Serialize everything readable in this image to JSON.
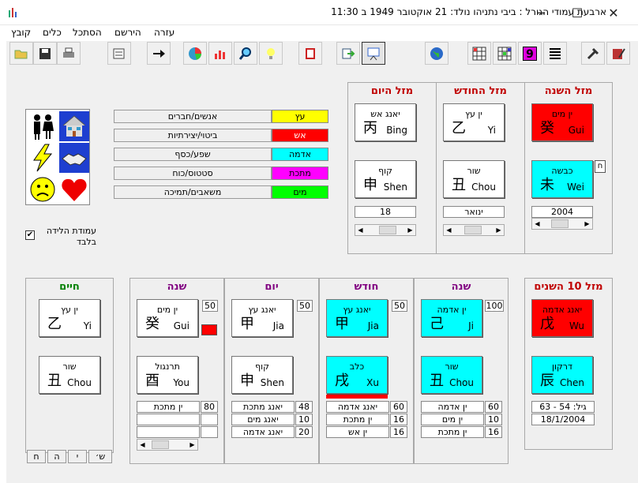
{
  "window": {
    "title": "ארבעת עמודי הגורל : ביבי נתניהו   נולד: 21 אוקטובר 1949 ב 11:30",
    "min": "─",
    "max": "☐",
    "close": "✕"
  },
  "menu": [
    "קובץ",
    "כלים",
    "הסתכל",
    "הירשם",
    "עזרה"
  ],
  "toolbar_icons": [
    "open-folder-icon",
    "save-icon",
    "print-icon",
    "properties-icon",
    "arrow-right-icon",
    "pie-chart-icon",
    "bar-chart-icon",
    "magnifier-icon",
    "bulb-icon",
    "book-icon",
    "export-icon",
    "presentation-icon",
    "globe-icon",
    "grid-a-icon",
    "grid-b-icon",
    "nine-icon",
    "list-lines-icon",
    "tools-icon",
    "book-pen-icon"
  ],
  "toolbar_nine": "9",
  "elements": [
    {
      "label": "אנשים/חברים",
      "chip": "עץ",
      "color": "#ffff00"
    },
    {
      "label": "ביטוי/יצירתיות",
      "chip": "אש",
      "color": "#ff0000"
    },
    {
      "label": "שפע/כסף",
      "chip": "אדמה",
      "color": "#00ffff"
    },
    {
      "label": "סטטוס/כוח",
      "chip": "מתכת",
      "color": "#ff00ff"
    },
    {
      "label": "משאבים/תמיכה",
      "chip": "מים",
      "color": "#00ff00"
    }
  ],
  "checkbox": {
    "label_1": "עמודת הלידה",
    "label_2": "בלבד",
    "checked": true,
    "mark": "✔"
  },
  "luck": [
    {
      "title": "מזל היום",
      "stem": {
        "name": "יאנג אש",
        "char": "丙",
        "pinyin": "Bing",
        "bg": "#ffffff"
      },
      "branch": {
        "name": "קוף",
        "char": "申",
        "pinyin": "Shen",
        "bg": "#ffffff"
      },
      "field": "18"
    },
    {
      "title": "מזל החודש",
      "stem": {
        "name": "ין עץ",
        "char": "乙",
        "pinyin": "Yi",
        "bg": "#ffffff"
      },
      "branch": {
        "name": "שור",
        "char": "丑",
        "pinyin": "Chou",
        "bg": "#ffffff"
      },
      "field": "ינואר"
    },
    {
      "title": "מזל השנה",
      "stem": {
        "name": "ין מים",
        "char": "癸",
        "pinyin": "Gui",
        "bg": "#ff0000"
      },
      "branch": {
        "name": "כבשה",
        "char": "未",
        "pinyin": "Wei",
        "bg": "#00ffff"
      },
      "field": "2004"
    }
  ],
  "small_button": "ח",
  "life": {
    "title": "חיים",
    "stem": {
      "name": "ין עץ",
      "char": "乙",
      "pinyin": "Yi"
    },
    "branch": {
      "name": "שור",
      "char": "丑",
      "pinyin": "Chou"
    }
  },
  "bottom_buttons": [
    "ח",
    "ה",
    "י",
    "ש׳"
  ],
  "pillars": [
    {
      "title": "שנה",
      "title_color": "#800080",
      "score": "50",
      "stem": {
        "name": "ין מים",
        "char": "癸",
        "pinyin": "Gui",
        "bg": "#ffffff"
      },
      "branch": {
        "name": "תרנגול",
        "char": "酉",
        "pinyin": "You",
        "bg": "#ffffff"
      },
      "hidden": [
        {
          "name": "ין מתכת",
          "val": "80"
        },
        {
          "name": "",
          "val": ""
        },
        {
          "name": "",
          "val": ""
        }
      ]
    },
    {
      "title": "יום",
      "title_color": "#800080",
      "score": "50",
      "stem": {
        "name": "יאנג עץ",
        "char": "甲",
        "pinyin": "Jia",
        "bg": "#ffffff"
      },
      "branch": {
        "name": "קוף",
        "char": "申",
        "pinyin": "Shen",
        "bg": "#ffffff"
      },
      "hidden": [
        {
          "name": "יאנג מתכת",
          "val": "48"
        },
        {
          "name": "יאנג מים",
          "val": "10"
        },
        {
          "name": "יאנג אדמה",
          "val": "20"
        }
      ]
    },
    {
      "title": "חודש",
      "title_color": "#800080",
      "score": "50",
      "stem": {
        "name": "יאנג עץ",
        "char": "甲",
        "pinyin": "Jia",
        "bg": "#00ffff"
      },
      "branch": {
        "name": "כלב",
        "char": "戌",
        "pinyin": "Xu",
        "bg": "#00ffff"
      },
      "hidden": [
        {
          "name": "יאנג אדמה",
          "val": "60"
        },
        {
          "name": "ין מתכת",
          "val": "16"
        },
        {
          "name": "ין אש",
          "val": "16"
        }
      ]
    },
    {
      "title": "שנה",
      "title_color": "#800080",
      "score": "100",
      "stem": {
        "name": "ין אדמה",
        "char": "己",
        "pinyin": "Ji",
        "bg": "#00ffff"
      },
      "branch": {
        "name": "שור",
        "char": "丑",
        "pinyin": "Chou",
        "bg": "#00ffff"
      },
      "hidden": [
        {
          "name": "ין אדמה",
          "val": "60"
        },
        {
          "name": "ין מים",
          "val": "10"
        },
        {
          "name": "ין מתכת",
          "val": "16"
        }
      ]
    }
  ],
  "ten_year": {
    "title": "מזל 10 השנים",
    "stem": {
      "name": "יאנג אדמה",
      "char": "戊",
      "pinyin": "Wu",
      "bg": "#ff0000"
    },
    "branch": {
      "name": "דרקון",
      "char": "辰",
      "pinyin": "Chen",
      "bg": "#00ffff"
    },
    "age": "גיל: 54 - 63",
    "date": "18/1/2004"
  },
  "colors": {
    "title_red": "#c00000",
    "title_green": "#008000",
    "title_purple": "#800080"
  }
}
